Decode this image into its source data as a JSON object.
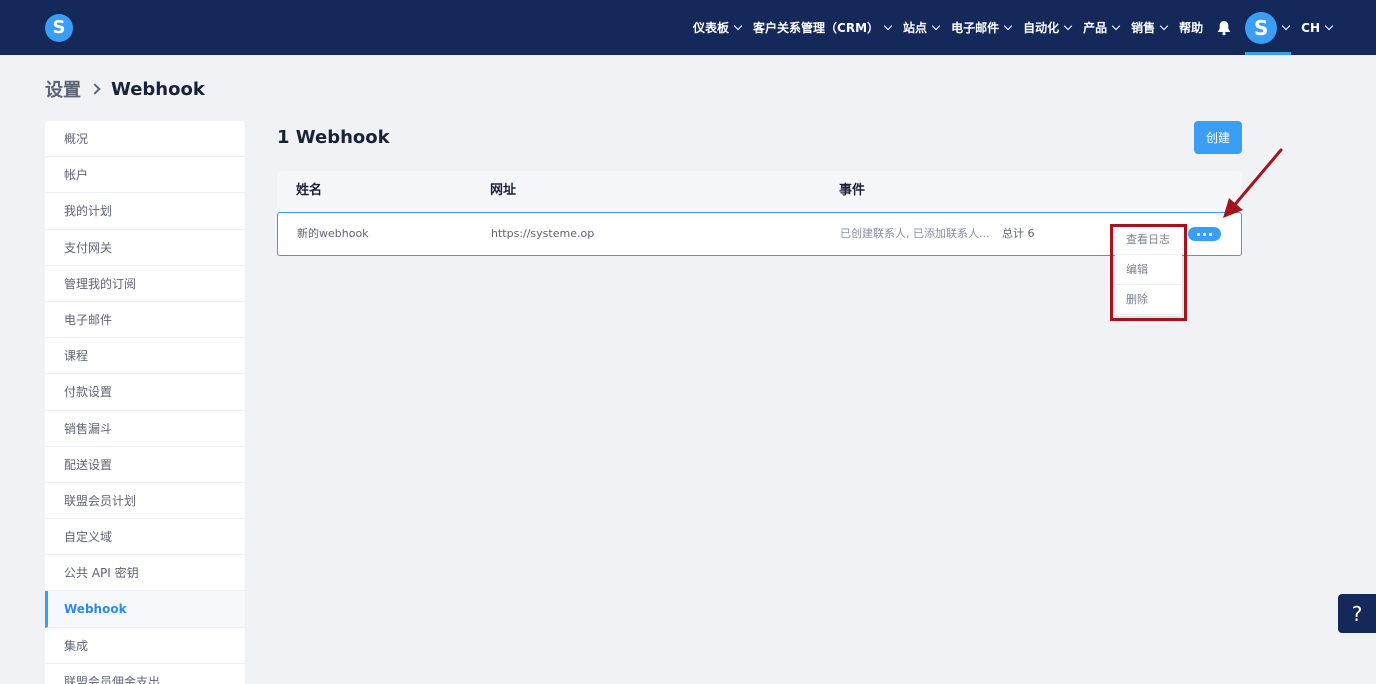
{
  "brand": {
    "logo_letter": "S"
  },
  "nav": {
    "items": [
      {
        "label": "仪表板",
        "dropdown": true
      },
      {
        "label": "客户关系管理（CRM）",
        "dropdown": true
      },
      {
        "label": "站点",
        "dropdown": true
      },
      {
        "label": "电子邮件",
        "dropdown": true
      },
      {
        "label": "自动化",
        "dropdown": true
      },
      {
        "label": "产品",
        "dropdown": true
      },
      {
        "label": "销售",
        "dropdown": true
      },
      {
        "label": "帮助",
        "dropdown": false
      }
    ],
    "notification_icon": "bell-icon",
    "avatar_letter": "S",
    "language": "CH"
  },
  "breadcrumb": {
    "root": "设置",
    "current": "Webhook"
  },
  "sidebar": {
    "items": [
      {
        "label": "概况"
      },
      {
        "label": "帐户"
      },
      {
        "label": "我的计划"
      },
      {
        "label": "支付网关"
      },
      {
        "label": "管理我的订阅"
      },
      {
        "label": "电子邮件"
      },
      {
        "label": "课程"
      },
      {
        "label": "付款设置"
      },
      {
        "label": "销售漏斗"
      },
      {
        "label": "配送设置"
      },
      {
        "label": "联盟会员计划"
      },
      {
        "label": "自定义域"
      },
      {
        "label": "公共 API 密钥"
      },
      {
        "label": "Webhook",
        "active": true
      },
      {
        "label": "集成"
      },
      {
        "label": "联盟会员佣金支出"
      }
    ]
  },
  "main": {
    "title": "1 Webhook",
    "create_label": "创建",
    "columns": {
      "name": "姓名",
      "url": "网址",
      "events": "事件"
    },
    "rows": [
      {
        "name": "新的webhook",
        "url": "https://systeme.op",
        "events": "已创建联系人, 已添加联系人...",
        "total_label": "总计",
        "total_count": "6"
      }
    ],
    "row_menu": [
      {
        "label": "查看日志"
      },
      {
        "label": "编辑"
      },
      {
        "label": "删除"
      }
    ]
  },
  "help": {
    "label": "?"
  },
  "colors": {
    "topbar": "#14285a",
    "accent": "#3a9ef5",
    "annotation": "#a3141c",
    "background": "#f0f2f6"
  }
}
